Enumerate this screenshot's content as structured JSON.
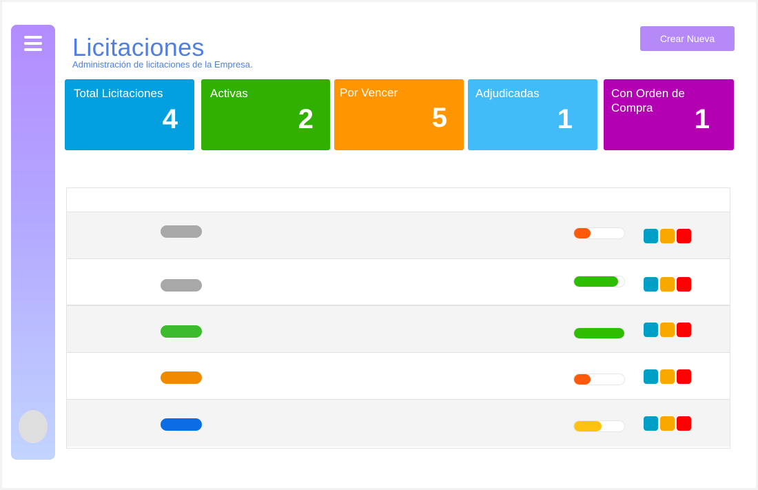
{
  "header": {
    "title": "Licitaciones",
    "subtitle": "Administración de licitaciones de la Empresa.",
    "create_label": "Crear Nueva"
  },
  "sidebar": {
    "menu_icon": "hamburger-menu-icon",
    "avatar": "avatar"
  },
  "cards": [
    {
      "label": "Total Licitaciones",
      "value": "4",
      "color": "#02a0de"
    },
    {
      "label": "Activas",
      "value": "2",
      "color": "#30b000"
    },
    {
      "label": "Por Vencer",
      "value": "5",
      "color": "#ff9500"
    },
    {
      "label": "Adjudicadas",
      "value": "1",
      "color": "#42bbf9"
    },
    {
      "label": "Con Orden de Compra",
      "value": "1",
      "color": "#b300b3"
    }
  ],
  "table": {
    "rows": [
      {
        "status_color": "#a8a8a8",
        "progress": 0.33,
        "progress_color": "#ff5a0a"
      },
      {
        "status_color": "#a8a8a8",
        "progress": 0.88,
        "progress_color": "#2ebd00"
      },
      {
        "status_color": "#3cbb2c",
        "progress": 1.0,
        "progress_color": "#2ebd00"
      },
      {
        "status_color": "#f28a00",
        "progress": 0.33,
        "progress_color": "#ff5a0a"
      },
      {
        "status_color": "#0a6de6",
        "progress": 0.55,
        "progress_color": "#ffc211"
      }
    ],
    "action_colors": [
      "#00a0c6",
      "#f9a800",
      "#ff0000"
    ],
    "action_icons": [
      "view-action-icon",
      "edit-action-icon",
      "delete-action-icon"
    ]
  }
}
